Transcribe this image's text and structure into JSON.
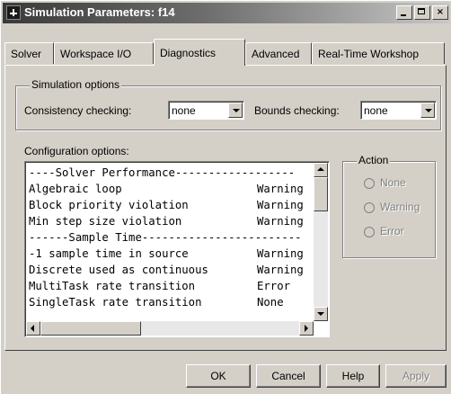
{
  "window": {
    "title": "Simulation Parameters: f14",
    "colors": {
      "face": "#d4d0c8",
      "title_dark": "#3a3a3a",
      "disabled_text": "#808080"
    }
  },
  "titlebar_buttons": {
    "minimize": "minimize-icon",
    "maximize": "maximize-icon",
    "close": "×"
  },
  "tabs": [
    {
      "label": "Solver"
    },
    {
      "label": "Workspace I/O"
    },
    {
      "label": "Diagnostics"
    },
    {
      "label": "Advanced"
    },
    {
      "label": "Real-Time Workshop"
    }
  ],
  "active_tab": "Diagnostics",
  "simulation_options": {
    "group_label": "Simulation options",
    "consistency_label": "Consistency checking:",
    "consistency_value": "none",
    "bounds_label": "Bounds checking:",
    "bounds_value": "none"
  },
  "configuration": {
    "label": "Configuration options:",
    "rows": [
      {
        "name": "----Solver Performance------------------",
        "status": ""
      },
      {
        "name": "Algebraic loop",
        "status": "Warning"
      },
      {
        "name": "Block priority violation",
        "status": "Warning"
      },
      {
        "name": "Min step size violation",
        "status": "Warning"
      },
      {
        "name": "------Sample Time------------------------",
        "status": ""
      },
      {
        "name": "-1 sample time in source",
        "status": "Warning"
      },
      {
        "name": "Discrete used as continuous",
        "status": "Warning"
      },
      {
        "name": "MultiTask rate transition",
        "status": "Error"
      },
      {
        "name": "SingleTask rate transition",
        "status": "None"
      }
    ]
  },
  "action": {
    "group_label": "Action",
    "options": [
      {
        "label": "None"
      },
      {
        "label": "Warning"
      },
      {
        "label": "Error"
      }
    ]
  },
  "buttons": {
    "ok": "OK",
    "cancel": "Cancel",
    "help": "Help",
    "apply": "Apply"
  }
}
